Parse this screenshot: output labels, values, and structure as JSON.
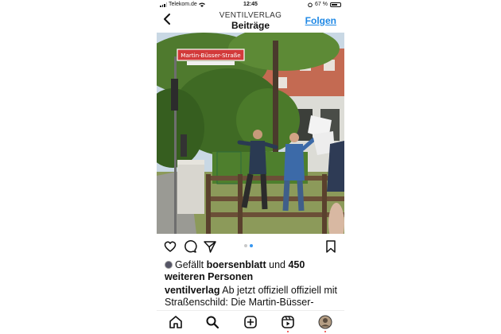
{
  "status_bar": {
    "carrier": "Telekom.de",
    "time": "12:45",
    "battery": "67 %"
  },
  "header": {
    "account": "VENTILVERLAG",
    "section": "Beiträge",
    "follow_label": "Folgen",
    "back_icon": "chevron-left-icon"
  },
  "post": {
    "street_sign": "Martin-Büsser-Straße",
    "media_index": 2,
    "media_count": 2,
    "likes_prefix": "Gefällt",
    "liked_by": "boersenblatt",
    "likes_connector": "und",
    "others_count": "450",
    "others_text": "weiteren Personen",
    "caption_user": "ventilverlag",
    "caption_text": "Ab jetzt offiziell offiziell mit Straßenschild: Die Martin-Büsser-"
  },
  "actions": [
    "heart-icon",
    "comment-icon",
    "share-icon",
    "bookmark-icon"
  ],
  "tabs": [
    "home-icon",
    "search-icon",
    "create-icon",
    "reels-icon",
    "profile-icon"
  ],
  "colors": {
    "accent": "#1e88e5",
    "sign_red": "#d23a3a",
    "text": "#111111"
  }
}
